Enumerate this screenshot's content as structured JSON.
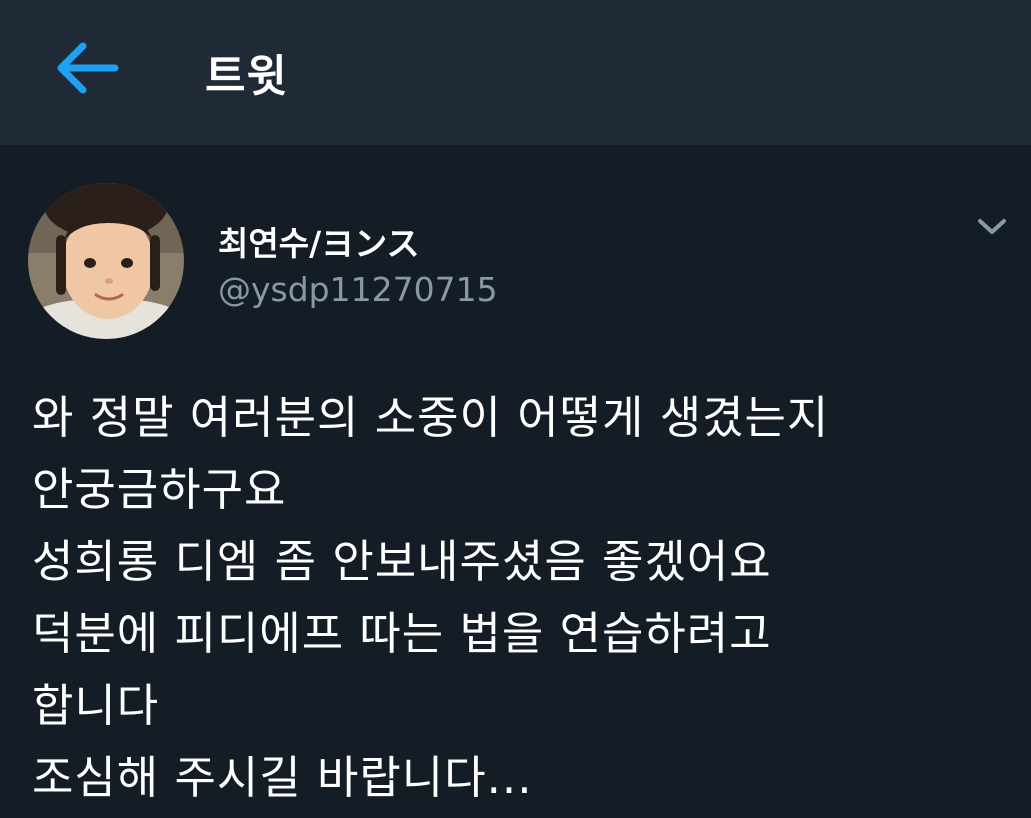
{
  "header": {
    "title": "트윗",
    "back_icon": "arrow-left-icon"
  },
  "tweet": {
    "author": {
      "display_name": "최연수/ヨンス",
      "handle": "@ysdp11270715"
    },
    "menu_icon": "chevron-down-icon",
    "lines": [
      "와 정말 여러분의 소중이 어떻게 생겼는지",
      "안궁금하구요",
      "성희롱 디엠 좀 안보내주셨음 좋겠어요",
      "덕분에 피디에프 따는 법을 연습하려고",
      "합니다",
      "조심해 주시길 바랍니다..."
    ]
  },
  "colors": {
    "background": "#141d26",
    "header_background": "#1f2a36",
    "accent": "#1da1f2",
    "secondary_text": "#8899a6"
  }
}
